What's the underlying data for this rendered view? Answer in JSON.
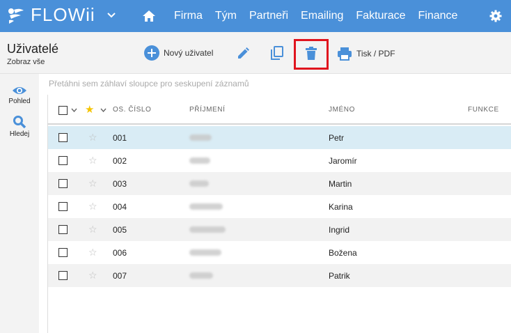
{
  "brand": {
    "name": "FLOWii"
  },
  "nav": {
    "items": [
      "Firma",
      "Tým",
      "Partneři",
      "Emailing",
      "Fakturace",
      "Finance"
    ]
  },
  "page": {
    "title": "Uživatelé",
    "subtitle": "Zobraz vše"
  },
  "toolbar": {
    "new_user": "Nový uživatel",
    "print_pdf": "Tisk / PDF"
  },
  "rail": {
    "view": "Pohled",
    "search": "Hledej"
  },
  "grid": {
    "group_hint": "Přetáhni sem záhlaví sloupce pro seskupení záznamů",
    "columns": [
      "OS. ČÍSLO",
      "PŘÍJMENÍ",
      "JMÉNO",
      "FUNKCE"
    ],
    "rows": [
      {
        "id": "001",
        "surname": "Pravel",
        "first_name": "Petr"
      },
      {
        "id": "002",
        "surname": "Novák",
        "first_name": "Jaromír"
      },
      {
        "id": "003",
        "surname": "Čížek",
        "first_name": "Martin"
      },
      {
        "id": "004",
        "surname": "Krejčová",
        "first_name": "Karina"
      },
      {
        "id": "005",
        "surname": "Brejchová",
        "first_name": "Ingrid"
      },
      {
        "id": "006",
        "surname": "Hanlová",
        "first_name": "Božena"
      },
      {
        "id": "007",
        "surname": "Mrázek",
        "first_name": "Patrik"
      }
    ]
  },
  "colors": {
    "accent": "#4a90d9",
    "highlight": "#e0141e",
    "selected_row": "#d9ecf5"
  }
}
